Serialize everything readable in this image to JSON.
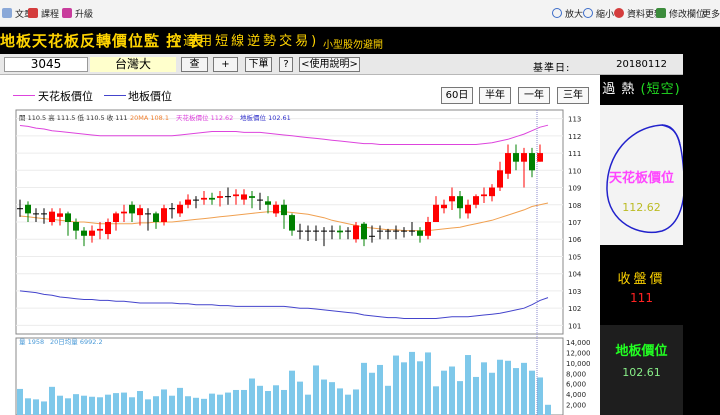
{
  "menubar": {
    "items": [
      {
        "label": "文章",
        "icon": "document-icon"
      },
      {
        "label": "課程",
        "icon": "course-icon"
      },
      {
        "label": "升級",
        "icon": "upgrade-icon"
      },
      {
        "label": "放大",
        "icon": "zoom-in-icon"
      },
      {
        "label": "縮小",
        "icon": "zoom-out-icon"
      },
      {
        "label": "資料更新",
        "icon": "refresh-icon"
      },
      {
        "label": "修改欄位",
        "icon": "edit-columns-icon"
      },
      {
        "label": "更多",
        "icon": "more-icon"
      }
    ]
  },
  "titlebar": {
    "main": "地板天花板反轉價位監 控 表",
    "sub": "(適用短線逆勢交易)",
    "note": "小型股勿避開"
  },
  "stock": {
    "code": "3045",
    "name": "台灣大",
    "buttons": [
      "查",
      "+",
      "下單",
      "?",
      "<使用說明>"
    ],
    "base_date_label": "基準日:",
    "base_date": "20180112"
  },
  "legend": {
    "ceiling_label": "天花板價位",
    "floor_label": "地板價位",
    "ranges": [
      "60日",
      "半年",
      "一年",
      "三年"
    ]
  },
  "chart_info": {
    "ohlc": "開 110.5  高 111.5  低 110.5  收 111",
    "ma": "20MA 108.1",
    "ceiling": "天花板價位 112.62",
    "floor": "地板價位 102.61",
    "vol": "量 1958",
    "vol_ma": "20日均量 6992.2"
  },
  "colors": {
    "up": "#ff0000",
    "down": "#008000",
    "ceiling_line": "#dd44dd",
    "floor_line": "#4444cc",
    "ma_line": "#f0a050",
    "volume": "#7ec8ea"
  },
  "chart_data": {
    "type": "candlestick",
    "price_axis": {
      "ylim": [
        100.5,
        113.5
      ],
      "ticks": [
        101,
        102,
        103,
        104,
        105,
        106,
        107,
        108,
        109,
        110,
        111,
        112,
        113
      ]
    },
    "volume_axis": {
      "ylim": [
        0,
        14000
      ],
      "ticks": [
        "14,000",
        "12,000",
        "10,000",
        "8,000",
        "6,000",
        "4,000",
        "2,000"
      ]
    },
    "candles": [
      {
        "o": 107.8,
        "h": 108.3,
        "c": 107.8,
        "l": 107.3
      },
      {
        "o": 108,
        "h": 108.2,
        "c": 107.5,
        "l": 107.0
      },
      {
        "o": 107.5,
        "h": 107.8,
        "c": 107.5,
        "l": 107.0
      },
      {
        "o": 107.5,
        "h": 107.8,
        "c": 107.5,
        "l": 106.9
      },
      {
        "o": 107.0,
        "h": 107.8,
        "c": 107.6,
        "l": 106.8
      },
      {
        "o": 107.3,
        "h": 107.8,
        "c": 107.5,
        "l": 106.8
      },
      {
        "o": 107.5,
        "h": 107.6,
        "c": 107.0,
        "l": 106.2
      },
      {
        "o": 107.0,
        "h": 107.2,
        "c": 106.5,
        "l": 106.0
      },
      {
        "o": 106.5,
        "h": 106.7,
        "c": 106.2,
        "l": 105.6
      },
      {
        "o": 106.2,
        "h": 106.8,
        "c": 106.5,
        "l": 105.8
      },
      {
        "o": 106.5,
        "h": 107.0,
        "c": 106.6,
        "l": 106.0
      },
      {
        "o": 106.3,
        "h": 107.2,
        "c": 107.0,
        "l": 106.0
      },
      {
        "o": 107.0,
        "h": 107.6,
        "c": 107.5,
        "l": 106.5
      },
      {
        "o": 107.5,
        "h": 108.0,
        "c": 107.6,
        "l": 107.0
      },
      {
        "o": 108.0,
        "h": 108.2,
        "c": 107.5,
        "l": 107.0
      },
      {
        "o": 107.4,
        "h": 108.0,
        "c": 107.8,
        "l": 106.8
      },
      {
        "o": 107.5,
        "h": 107.8,
        "c": 107.5,
        "l": 106.5
      },
      {
        "o": 107.5,
        "h": 107.6,
        "c": 107.0,
        "l": 106.6
      },
      {
        "o": 107.0,
        "h": 108.0,
        "c": 107.8,
        "l": 106.8
      },
      {
        "o": 107.8,
        "h": 108.1,
        "c": 107.8,
        "l": 107.2
      },
      {
        "o": 107.5,
        "h": 108.2,
        "c": 108.0,
        "l": 107.3
      },
      {
        "o": 108.0,
        "h": 108.6,
        "c": 108.3,
        "l": 107.8
      },
      {
        "o": 108.3,
        "h": 108.5,
        "c": 108.3,
        "l": 107.8
      },
      {
        "o": 108.3,
        "h": 108.8,
        "c": 108.4,
        "l": 108.0
      },
      {
        "o": 108.4,
        "h": 108.7,
        "c": 108.3,
        "l": 108.0
      },
      {
        "o": 108.4,
        "h": 108.8,
        "c": 108.5,
        "l": 107.9
      },
      {
        "o": 108.5,
        "h": 109.0,
        "c": 108.5,
        "l": 108.0
      },
      {
        "o": 108.5,
        "h": 108.9,
        "c": 108.6,
        "l": 108.0
      },
      {
        "o": 108.3,
        "h": 108.9,
        "c": 108.6,
        "l": 108.0
      },
      {
        "o": 108.5,
        "h": 108.8,
        "c": 108.4,
        "l": 107.8
      },
      {
        "o": 108.3,
        "h": 108.7,
        "c": 108.3,
        "l": 107.7
      },
      {
        "o": 108.2,
        "h": 108.5,
        "c": 108.0,
        "l": 107.5
      },
      {
        "o": 107.5,
        "h": 108.2,
        "c": 108.0,
        "l": 107.3
      },
      {
        "o": 108.0,
        "h": 108.3,
        "c": 107.4,
        "l": 106.6
      },
      {
        "o": 107.4,
        "h": 107.5,
        "c": 106.5,
        "l": 106.2
      },
      {
        "o": 106.5,
        "h": 106.9,
        "c": 106.5,
        "l": 106.0
      },
      {
        "o": 106.5,
        "h": 106.8,
        "c": 106.5,
        "l": 105.9
      },
      {
        "o": 106.5,
        "h": 106.8,
        "c": 106.5,
        "l": 105.9
      },
      {
        "o": 106.5,
        "h": 106.7,
        "c": 106.5,
        "l": 105.6
      },
      {
        "o": 106.5,
        "h": 106.8,
        "c": 106.5,
        "l": 106.0
      },
      {
        "o": 106.5,
        "h": 106.8,
        "c": 106.4,
        "l": 106.0
      },
      {
        "o": 106.5,
        "h": 106.7,
        "c": 106.5,
        "l": 106.0
      },
      {
        "o": 106.0,
        "h": 107.0,
        "c": 106.8,
        "l": 105.8
      },
      {
        "o": 106.9,
        "h": 107.0,
        "c": 106.0,
        "l": 105.6
      },
      {
        "o": 106.2,
        "h": 106.8,
        "c": 106.2,
        "l": 105.8
      },
      {
        "o": 106.5,
        "h": 106.8,
        "c": 106.5,
        "l": 106.0
      },
      {
        "o": 106.5,
        "h": 106.6,
        "c": 106.5,
        "l": 106.0
      },
      {
        "o": 106.5,
        "h": 106.8,
        "c": 106.5,
        "l": 106.0
      },
      {
        "o": 106.5,
        "h": 106.7,
        "c": 106.5,
        "l": 106.1
      },
      {
        "o": 106.5,
        "h": 107.0,
        "c": 106.5,
        "l": 106.2
      },
      {
        "o": 106.5,
        "h": 106.7,
        "c": 106.2,
        "l": 105.8
      },
      {
        "o": 106.2,
        "h": 107.3,
        "c": 107.0,
        "l": 106.0
      },
      {
        "o": 107.0,
        "h": 108.5,
        "c": 108.0,
        "l": 107.0
      },
      {
        "o": 107.8,
        "h": 108.3,
        "c": 108.0,
        "l": 107.5
      },
      {
        "o": 108.2,
        "h": 109.0,
        "c": 108.5,
        "l": 107.7
      },
      {
        "o": 108.5,
        "h": 108.8,
        "c": 107.8,
        "l": 107.2
      },
      {
        "o": 107.5,
        "h": 108.3,
        "c": 108.0,
        "l": 107.2
      },
      {
        "o": 108.0,
        "h": 108.6,
        "c": 108.5,
        "l": 107.8
      },
      {
        "o": 108.5,
        "h": 109.0,
        "c": 108.6,
        "l": 108.1
      },
      {
        "o": 108.5,
        "h": 109.2,
        "c": 109.0,
        "l": 108.2
      },
      {
        "o": 109.0,
        "h": 110.5,
        "c": 110.0,
        "l": 108.8
      },
      {
        "o": 109.8,
        "h": 111.5,
        "c": 111.0,
        "l": 109.5
      },
      {
        "o": 111.0,
        "h": 111.5,
        "c": 110.5,
        "l": 110.0
      },
      {
        "o": 110.5,
        "h": 111.3,
        "c": 111.0,
        "l": 109.0
      },
      {
        "o": 111.0,
        "h": 111.3,
        "c": 110.0,
        "l": 109.6
      },
      {
        "o": 110.5,
        "h": 111.5,
        "c": 111.0,
        "l": 110.5
      }
    ],
    "ceiling": [
      112.6,
      112.55,
      112.45,
      112.4,
      112.3,
      112.25,
      112.2,
      112.15,
      112.1,
      112.05,
      112.0,
      112.0,
      112.0,
      112.0,
      112.0,
      112.0,
      112.0,
      112.0,
      112.0,
      112.0,
      112.05,
      112.1,
      112.15,
      112.2,
      112.25,
      112.25,
      112.25,
      112.25,
      112.2,
      112.2,
      112.2,
      112.15,
      112.1,
      112.05,
      112.0,
      111.95,
      111.9,
      111.85,
      111.8,
      111.75,
      111.7,
      111.65,
      111.6,
      111.55,
      111.55,
      111.5,
      111.5,
      111.5,
      111.5,
      111.5,
      111.5,
      111.5,
      111.5,
      111.5,
      111.5,
      111.5,
      111.5,
      111.5,
      111.55,
      111.6,
      111.7,
      111.8,
      111.95,
      112.1,
      112.3,
      112.5,
      112.62
    ],
    "floor": [
      103.0,
      102.95,
      102.9,
      102.8,
      102.75,
      102.65,
      102.6,
      102.55,
      102.5,
      102.5,
      102.45,
      102.45,
      102.4,
      102.4,
      102.35,
      102.3,
      102.3,
      102.3,
      102.3,
      102.3,
      102.25,
      102.25,
      102.2,
      102.2,
      102.2,
      102.15,
      102.15,
      102.1,
      102.1,
      102.1,
      102.1,
      102.1,
      102.1,
      102.1,
      102.05,
      102.0,
      102.0,
      101.95,
      101.9,
      101.85,
      101.8,
      101.75,
      101.7,
      101.6,
      101.55,
      101.5,
      101.45,
      101.45,
      101.4,
      101.4,
      101.4,
      101.4,
      101.4,
      101.45,
      101.5,
      101.5,
      101.5,
      101.55,
      101.6,
      101.65,
      101.7,
      101.8,
      101.9,
      102.0,
      102.2,
      102.45,
      102.61
    ],
    "ma20": [
      107.35,
      107.3,
      107.25,
      107.2,
      107.15,
      107.1,
      107.05,
      107.0,
      107.0,
      106.95,
      106.9,
      106.9,
      106.9,
      106.9,
      106.9,
      106.95,
      106.95,
      107.0,
      107.0,
      107.0,
      107.05,
      107.1,
      107.15,
      107.2,
      107.25,
      107.3,
      107.35,
      107.4,
      107.45,
      107.5,
      107.55,
      107.6,
      107.6,
      107.6,
      107.55,
      107.5,
      107.45,
      107.35,
      107.25,
      107.1,
      107.0,
      106.9,
      106.8,
      106.7,
      106.65,
      106.6,
      106.55,
      106.55,
      106.5,
      106.5,
      106.5,
      106.5,
      106.55,
      106.6,
      106.65,
      106.7,
      106.8,
      106.9,
      107.0,
      107.1,
      107.25,
      107.4,
      107.55,
      107.7,
      107.9,
      108.0,
      108.1
    ],
    "volume": [
      5000,
      3200,
      3000,
      2600,
      5400,
      3700,
      3200,
      4000,
      3700,
      3500,
      3400,
      3900,
      4200,
      4300,
      3400,
      4600,
      3000,
      3600,
      4900,
      3700,
      5200,
      3600,
      3300,
      3100,
      4100,
      3900,
      4300,
      4800,
      4800,
      7000,
      5600,
      4600,
      5700,
      4800,
      8500,
      6400,
      3900,
      9500,
      6800,
      6300,
      5100,
      3900,
      4900,
      10000,
      8100,
      9600,
      5600,
      11400,
      10100,
      12100,
      10300,
      12000,
      5500,
      8500,
      9300,
      6500,
      11500,
      7300,
      10100,
      8100,
      10600,
      10400,
      9000,
      10000,
      8500,
      7200,
      1958
    ]
  }
}
